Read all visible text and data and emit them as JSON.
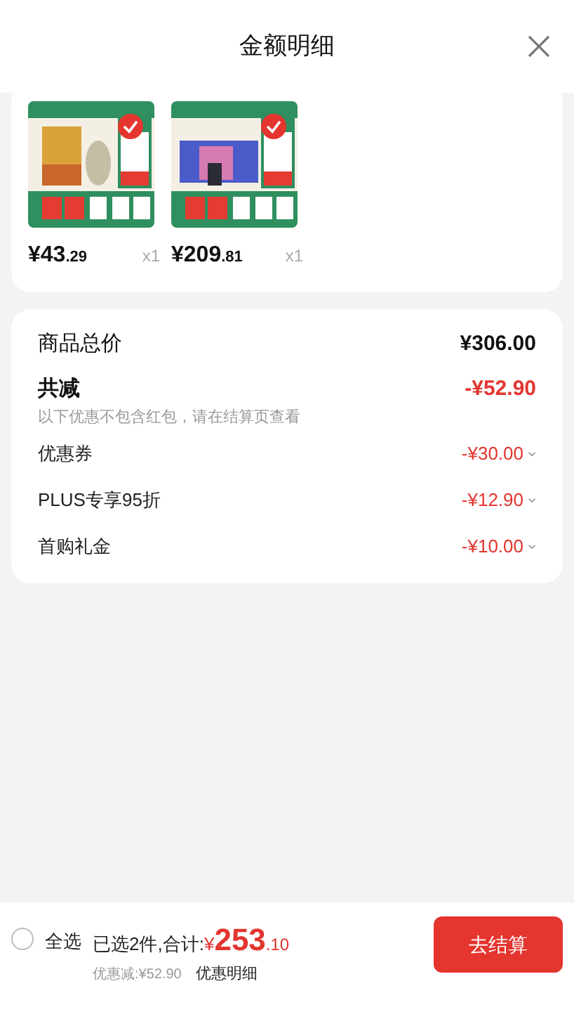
{
  "header": {
    "title": "金额明细"
  },
  "products": [
    {
      "price_main": "¥43",
      "price_decimal": ".29",
      "quantity": "x1",
      "checked": true
    },
    {
      "price_main": "¥209",
      "price_decimal": ".81",
      "quantity": "x1",
      "checked": true
    }
  ],
  "summary": {
    "total_label": "商品总价",
    "total_value": "¥306.00",
    "discount_label": "共减",
    "discount_value": "-¥52.90",
    "note": "以下优惠不包含红包，请在结算页查看",
    "items": [
      {
        "label": "优惠券",
        "value": "-¥30.00"
      },
      {
        "label": "PLUS专享95折",
        "value": "-¥12.90"
      },
      {
        "label": "首购礼金",
        "value": "-¥10.00"
      }
    ]
  },
  "footer": {
    "select_all": "全选",
    "select_all_checked": false,
    "selected_text": "已选2件,合计:",
    "currency": "¥",
    "total_main": "253",
    "total_decimal": ".10",
    "saved": "优惠减:¥52.90",
    "detail_link": "优惠明细",
    "checkout": "去结算"
  }
}
